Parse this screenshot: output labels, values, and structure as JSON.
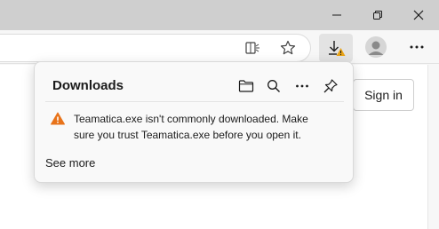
{
  "window": {
    "minimize_icon": "minimize-icon",
    "restore_icon": "restore-icon",
    "close_icon": "close-icon"
  },
  "toolbar": {
    "reader_icon": "immersive-reader-icon",
    "favorite_icon": "star-icon",
    "downloads_icon": "download-warning-icon",
    "profile_icon": "profile-avatar-icon",
    "more_icon": "more-icon"
  },
  "page": {
    "sign_in_label": "Sign in"
  },
  "downloads": {
    "title": "Downloads",
    "warning": "Teamatica.exe isn't commonly downloaded. Make sure you trust Teamatica.exe before you open it.",
    "see_more": "See more",
    "icons": [
      "folder-icon",
      "search-icon",
      "more-icon",
      "pin-icon"
    ]
  },
  "colors": {
    "warning": "#e8731a",
    "titlebar": "#cfcfcf",
    "flyout_bg": "#f9f9f9"
  }
}
